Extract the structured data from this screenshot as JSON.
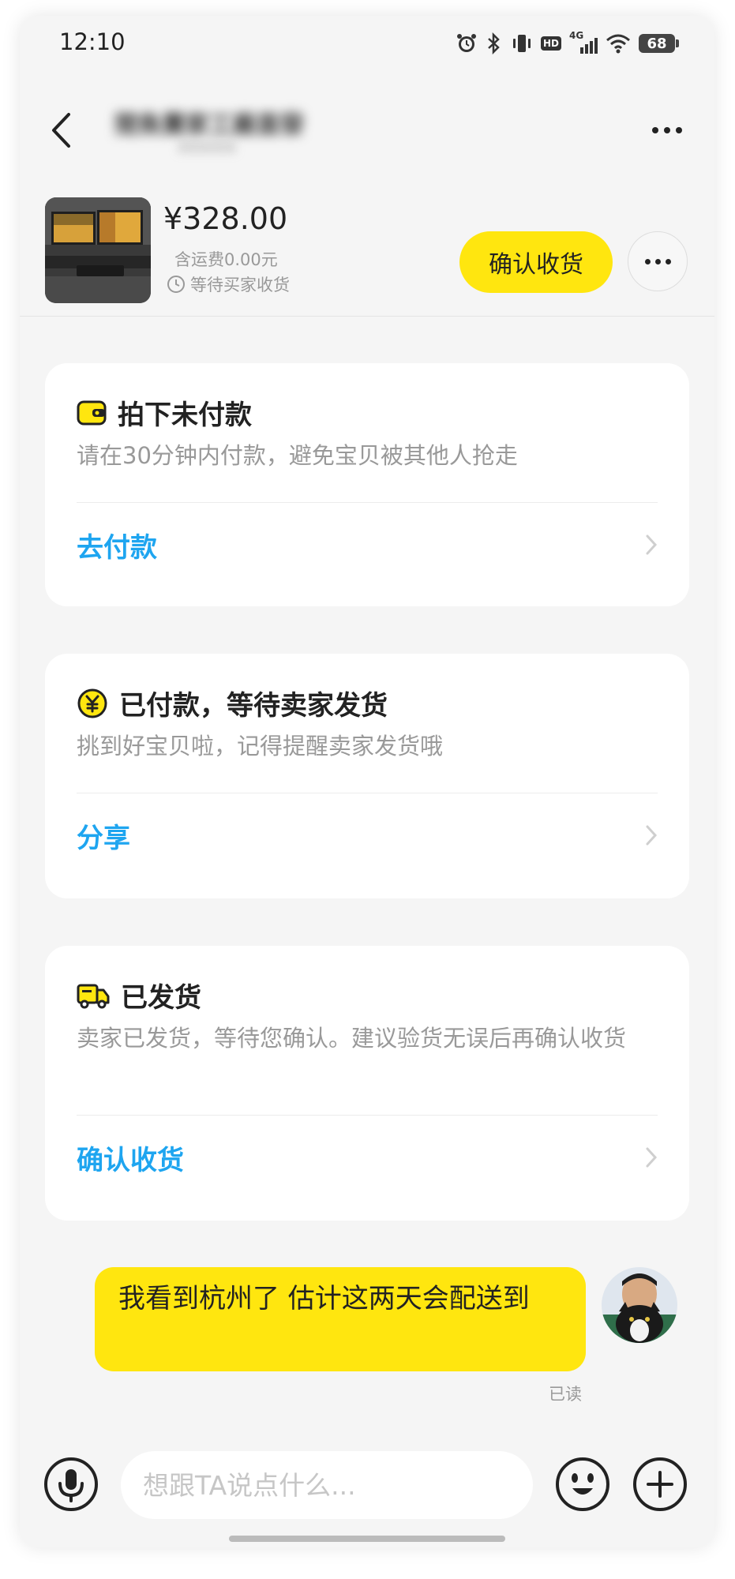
{
  "status_bar": {
    "time": "12:10",
    "icons": [
      "alarm-icon",
      "bluetooth-icon",
      "vibrate-icon",
      "hd-icon",
      "signal-4g-icon",
      "wifi-icon"
    ],
    "hd_label": "HD",
    "network_label": "4G",
    "battery": "68"
  },
  "header": {
    "title": "閒魚賣家工廠直發",
    "subtitle": "XXXXXX",
    "back_icon": "chevron-left-icon",
    "more_icon": "more-horizontal-icon"
  },
  "product": {
    "price": "¥328.00",
    "shipping": "含运费0.00元",
    "status": "等待买家收货",
    "confirm_button": "确认收货"
  },
  "cards": [
    {
      "icon": "wallet-icon",
      "title": "拍下未付款",
      "desc": "请在30分钟内付款，避免宝贝被其他人抢走",
      "action": "去付款"
    },
    {
      "icon": "yen-coin-icon",
      "title": "已付款，等待卖家发货",
      "desc": "挑到好宝贝啦，记得提醒卖家发货哦",
      "action": "分享"
    },
    {
      "icon": "truck-icon",
      "title": "已发货",
      "desc": "卖家已发货，等待您确认。建议验货无误后再确认收货",
      "action": "确认收货"
    }
  ],
  "message": {
    "text": "我看到杭州了 估计这两天会配送到",
    "read_status": "已读"
  },
  "input": {
    "placeholder": "想跟TA说点什么..."
  },
  "colors": {
    "accent_yellow": "#ffe60f",
    "link_blue": "#1ea5f0",
    "background": "#f5f5f5"
  }
}
